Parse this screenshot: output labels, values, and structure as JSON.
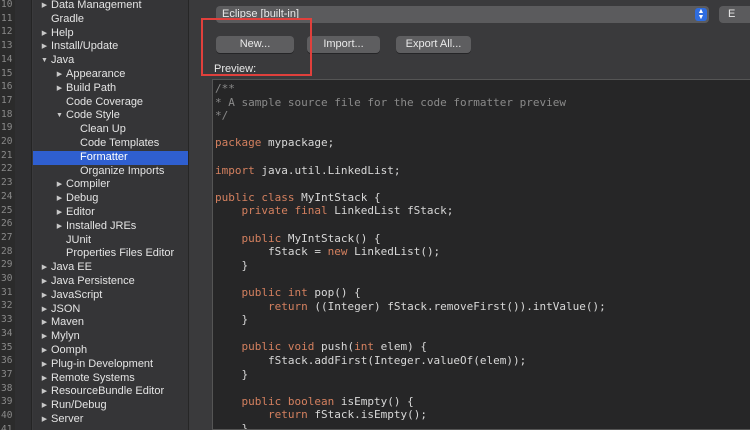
{
  "gutter": {
    "line_numbers": [
      "10",
      "11",
      "12",
      "13",
      "14",
      "15",
      "16",
      "17",
      "18",
      "19",
      "20",
      "21",
      "22",
      "23",
      "24",
      "25",
      "26",
      "27",
      "28",
      "29",
      "30",
      "31",
      "32",
      "33",
      "34",
      "35",
      "36",
      "37",
      "38",
      "39",
      "40",
      "41"
    ]
  },
  "tree": {
    "items": [
      {
        "label": "Data Management",
        "level": 0,
        "arrow": "right"
      },
      {
        "label": "Gradle",
        "level": 0,
        "arrow": "none"
      },
      {
        "label": "Help",
        "level": 0,
        "arrow": "right"
      },
      {
        "label": "Install/Update",
        "level": 0,
        "arrow": "right"
      },
      {
        "label": "Java",
        "level": 0,
        "arrow": "down"
      },
      {
        "label": "Appearance",
        "level": 1,
        "arrow": "right"
      },
      {
        "label": "Build Path",
        "level": 1,
        "arrow": "right"
      },
      {
        "label": "Code Coverage",
        "level": 1,
        "arrow": "none"
      },
      {
        "label": "Code Style",
        "level": 1,
        "arrow": "down"
      },
      {
        "label": "Clean Up",
        "level": 2,
        "arrow": "none"
      },
      {
        "label": "Code Templates",
        "level": 2,
        "arrow": "none"
      },
      {
        "label": "Formatter",
        "level": 2,
        "arrow": "none",
        "selected": true
      },
      {
        "label": "Organize Imports",
        "level": 2,
        "arrow": "none"
      },
      {
        "label": "Compiler",
        "level": 1,
        "arrow": "right"
      },
      {
        "label": "Debug",
        "level": 1,
        "arrow": "right"
      },
      {
        "label": "Editor",
        "level": 1,
        "arrow": "right"
      },
      {
        "label": "Installed JREs",
        "level": 1,
        "arrow": "right"
      },
      {
        "label": "JUnit",
        "level": 1,
        "arrow": "none"
      },
      {
        "label": "Properties Files Editor",
        "level": 1,
        "arrow": "none"
      },
      {
        "label": "Java EE",
        "level": 0,
        "arrow": "right"
      },
      {
        "label": "Java Persistence",
        "level": 0,
        "arrow": "right"
      },
      {
        "label": "JavaScript",
        "level": 0,
        "arrow": "right"
      },
      {
        "label": "JSON",
        "level": 0,
        "arrow": "right"
      },
      {
        "label": "Maven",
        "level": 0,
        "arrow": "right"
      },
      {
        "label": "Mylyn",
        "level": 0,
        "arrow": "right"
      },
      {
        "label": "Oomph",
        "level": 0,
        "arrow": "right"
      },
      {
        "label": "Plug-in Development",
        "level": 0,
        "arrow": "right"
      },
      {
        "label": "Remote Systems",
        "level": 0,
        "arrow": "right"
      },
      {
        "label": "ResourceBundle Editor",
        "level": 0,
        "arrow": "right"
      },
      {
        "label": "Run/Debug",
        "level": 0,
        "arrow": "right"
      },
      {
        "label": "Server",
        "level": 0,
        "arrow": "right"
      }
    ]
  },
  "panel": {
    "profile_select_value": "Eclipse [built-in]",
    "edit_label": "E",
    "new_label": "New...",
    "import_label": "Import...",
    "export_label": "Export All...",
    "preview_label": "Preview:"
  },
  "preview": {
    "lines": [
      [
        {
          "t": "/**",
          "c": "cm"
        }
      ],
      [
        {
          "t": "* A sample source file for the code formatter preview",
          "c": "cm"
        }
      ],
      [
        {
          "t": "*/",
          "c": "cm"
        }
      ],
      [],
      [
        {
          "t": "package",
          "c": "kw"
        },
        {
          "t": " mypackage;"
        }
      ],
      [],
      [
        {
          "t": "import",
          "c": "kw"
        },
        {
          "t": " java.util.LinkedList;"
        }
      ],
      [],
      [
        {
          "t": "public class",
          "c": "kw"
        },
        {
          "t": " MyIntStack {"
        }
      ],
      [
        {
          "t": "    "
        },
        {
          "t": "private final",
          "c": "kw"
        },
        {
          "t": " LinkedList fStack;"
        }
      ],
      [],
      [
        {
          "t": "    "
        },
        {
          "t": "public",
          "c": "kw"
        },
        {
          "t": " MyIntStack() {"
        }
      ],
      [
        {
          "t": "        fStack = "
        },
        {
          "t": "new",
          "c": "kw"
        },
        {
          "t": " LinkedList();"
        }
      ],
      [
        {
          "t": "    }"
        }
      ],
      [],
      [
        {
          "t": "    "
        },
        {
          "t": "public int",
          "c": "kw"
        },
        {
          "t": " pop() {"
        }
      ],
      [
        {
          "t": "        "
        },
        {
          "t": "return",
          "c": "kw"
        },
        {
          "t": " ((Integer) fStack.removeFirst()).intValue();"
        }
      ],
      [
        {
          "t": "    }"
        }
      ],
      [],
      [
        {
          "t": "    "
        },
        {
          "t": "public void",
          "c": "kw"
        },
        {
          "t": " push("
        },
        {
          "t": "int",
          "c": "kw"
        },
        {
          "t": " elem) {"
        }
      ],
      [
        {
          "t": "        fStack.addFirst(Integer.valueOf(elem));"
        }
      ],
      [
        {
          "t": "    }"
        }
      ],
      [],
      [
        {
          "t": "    "
        },
        {
          "t": "public boolean",
          "c": "kw"
        },
        {
          "t": " isEmpty() {"
        }
      ],
      [
        {
          "t": "        "
        },
        {
          "t": "return",
          "c": "kw"
        },
        {
          "t": " fStack.isEmpty();"
        }
      ],
      [
        {
          "t": "    }"
        }
      ],
      [
        {
          "t": "}"
        }
      ]
    ]
  }
}
